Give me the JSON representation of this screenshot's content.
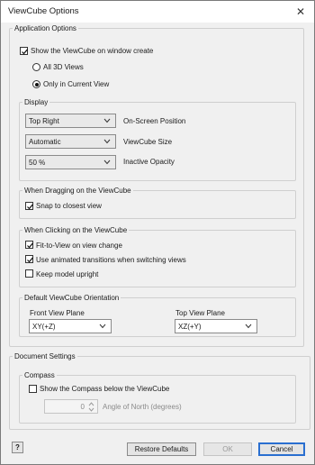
{
  "window": {
    "title": "ViewCube Options",
    "close_glyph": "✕"
  },
  "application_options": {
    "legend": "Application Options",
    "show_viewcube_label": "Show the ViewCube on window create",
    "show_viewcube_checked": true,
    "all_views_label": "All 3D Views",
    "current_view_label": "Only in Current View",
    "selected_view_option": "Only in Current View",
    "display": {
      "legend": "Display",
      "position": {
        "value": "Top Right",
        "label": "On-Screen Position"
      },
      "size": {
        "value": "Automatic",
        "label": "ViewCube Size"
      },
      "opacity": {
        "value": "50 %",
        "label": "Inactive Opacity"
      }
    },
    "dragging": {
      "legend": "When Dragging on the ViewCube",
      "snap_label": "Snap to closest view",
      "snap_checked": true
    },
    "clicking": {
      "legend": "When Clicking on the ViewCube",
      "fit_label": "Fit-to-View on view change",
      "fit_checked": true,
      "animated_label": "Use animated transitions when switching views",
      "animated_checked": true,
      "upright_label": "Keep model upright",
      "upright_checked": false
    },
    "orientation": {
      "legend": "Default ViewCube Orientation",
      "front_label": "Front View Plane",
      "front_value": "XY(+Z)",
      "top_label": "Top View Plane",
      "top_value": "XZ(+Y)"
    }
  },
  "document_settings": {
    "legend": "Document Settings",
    "compass": {
      "legend": "Compass",
      "show_label": "Show the Compass below the ViewCube",
      "show_checked": false,
      "angle_value": "0",
      "angle_label": "Angle of North (degrees)"
    }
  },
  "footer": {
    "help_glyph": "?",
    "restore_label": "Restore Defaults",
    "ok_label": "OK",
    "cancel_label": "Cancel"
  }
}
